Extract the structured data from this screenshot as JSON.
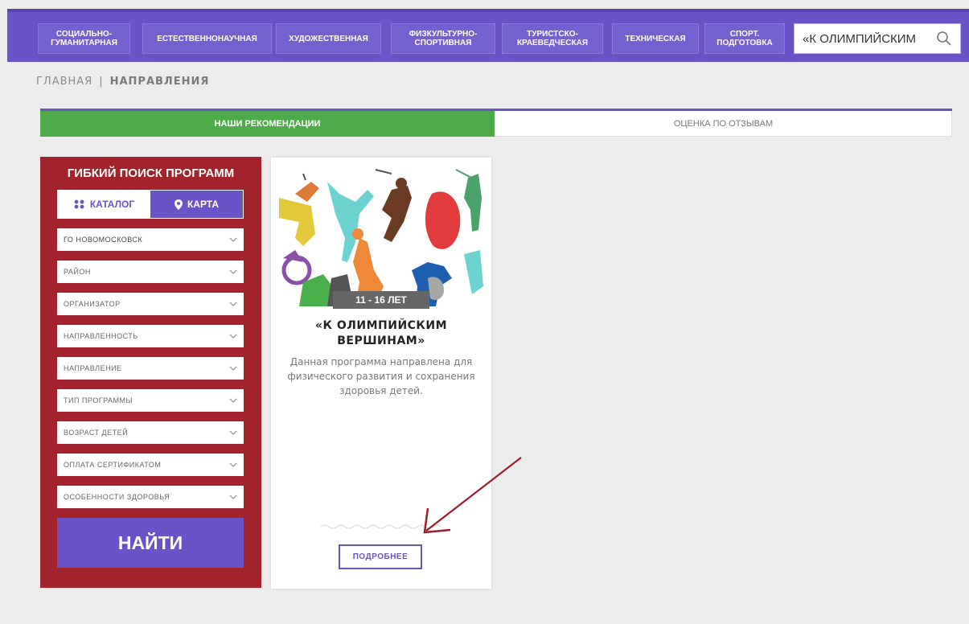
{
  "nav": {
    "items": [
      {
        "label": "СОЦИАЛЬНО-\nГУМАНИТАРНАЯ"
      },
      {
        "label": "ЕСТЕСТВЕННОНАУЧНАЯ"
      },
      {
        "label": "ХУДОЖЕСТВЕННАЯ"
      },
      {
        "label": "ФИЗКУЛЬТУРНО-\nСПОРТИВНАЯ"
      },
      {
        "label": "ТУРИСТСКО-\nКРАЕВЕДЧЕСКАЯ"
      },
      {
        "label": "ТЕХНИЧЕСКАЯ"
      },
      {
        "label": "СПОРТ.\nПОДГОТОВКА"
      }
    ],
    "search_value": "«К ОЛИМПИЙСКИМ"
  },
  "breadcrumb": {
    "home": "ГЛАВНАЯ",
    "separator": "|",
    "current": "НАПРАВЛЕНИЯ"
  },
  "tabs": {
    "recommendations": "НАШИ РЕКОМЕНДАЦИИ",
    "reviews": "ОЦЕНКА ПО ОТЗЫВАМ"
  },
  "filter": {
    "title": "ГИБКИЙ ПОИСК ПРОГРАММ",
    "catalog_label": "КАТАЛОГ",
    "map_label": "КАРТА",
    "selects": [
      "ГО НОВОМОСКОВСК",
      "РАЙОН",
      "ОРГАНИЗАТОР",
      "НАПРАВЛЕННОСТЬ",
      "НАПРАВЛЕНИЕ",
      "ТИП ПРОГРАММЫ",
      "ВОЗРАСТ ДЕТЕЙ",
      "ОПЛАТА СЕРТИФИКАТОМ",
      "ОСОБЕННОСТИ ЗДОРОВЬЯ"
    ],
    "find_label": "НАЙТИ"
  },
  "card": {
    "age": "11 - 16 ЛЕТ",
    "title": "«К ОЛИМПИЙСКИМ ВЕРШИНАМ»",
    "description": "Данная программа направлена для физического развития и сохранения здоровья детей.",
    "more_label": "ПОДРОБНЕЕ"
  },
  "colors": {
    "brand_purple": "#6a53c6",
    "filter_red": "#a2232c",
    "active_green": "#4fab4a",
    "arrow": "#9b1c2a"
  }
}
